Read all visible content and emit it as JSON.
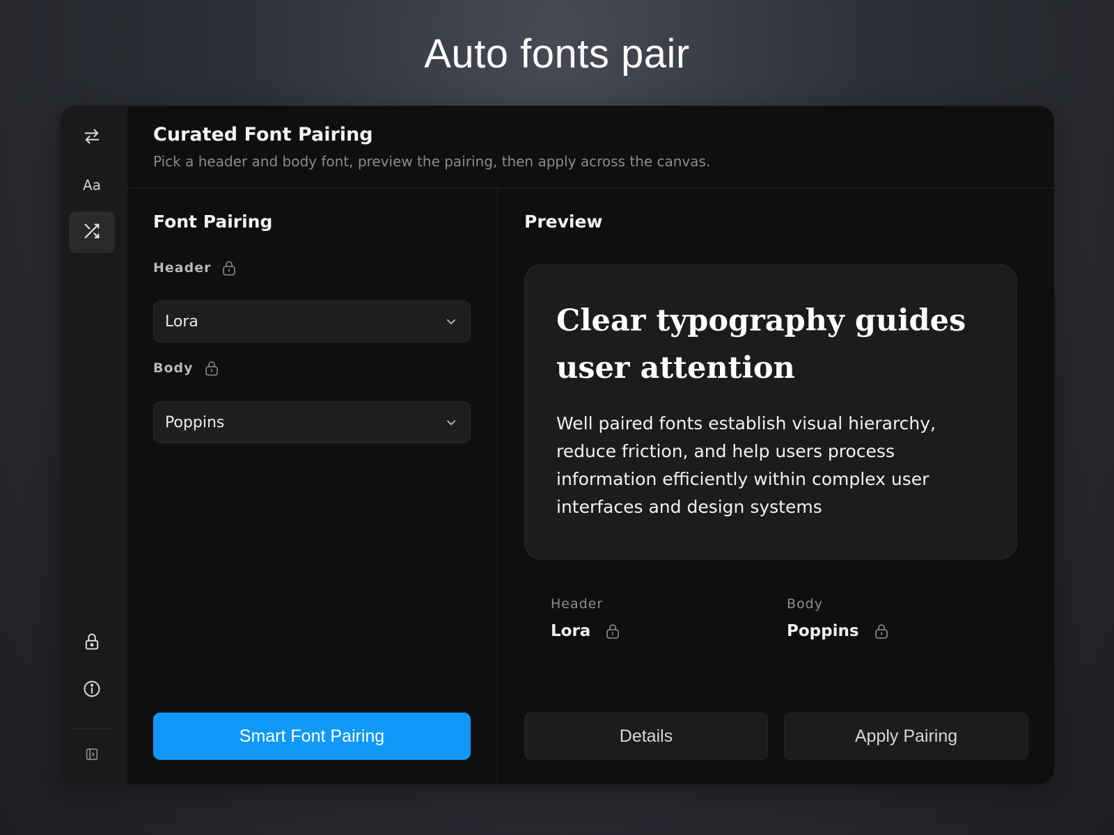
{
  "page": {
    "headline": "Auto fonts pair"
  },
  "rail": {
    "items": [
      {
        "icon": "swap-icon"
      },
      {
        "icon": "typography-icon",
        "text": "Aa"
      },
      {
        "icon": "shuffle-icon",
        "active": true
      }
    ],
    "bottom_items": [
      {
        "icon": "lock-icon"
      },
      {
        "icon": "info-icon"
      },
      {
        "icon": "sidebar-toggle-icon"
      }
    ]
  },
  "header": {
    "title": "Curated Font Pairing",
    "subtitle": "Pick a header and body font, preview the pairing, then apply across the canvas."
  },
  "pairing": {
    "title": "Font Pairing",
    "header_label": "Header",
    "header_value": "Lora",
    "body_label": "Body",
    "body_value": "Poppins",
    "smart_button": "Smart Font Pairing"
  },
  "preview": {
    "title": "Preview",
    "heading": "Clear typography guides user attention",
    "body": "Well paired fonts establish visual hierarchy, reduce friction, and help users process information efficiently within complex user interfaces and design systems",
    "header_label": "Header",
    "header_value": "Lora",
    "body_label": "Body",
    "body_value": "Poppins",
    "details_button": "Details",
    "apply_button": "Apply Pairing"
  },
  "colors": {
    "accent": "#0f98f5",
    "panel_bg": "#0f0f10",
    "card_bg": "#1c1c1e"
  }
}
